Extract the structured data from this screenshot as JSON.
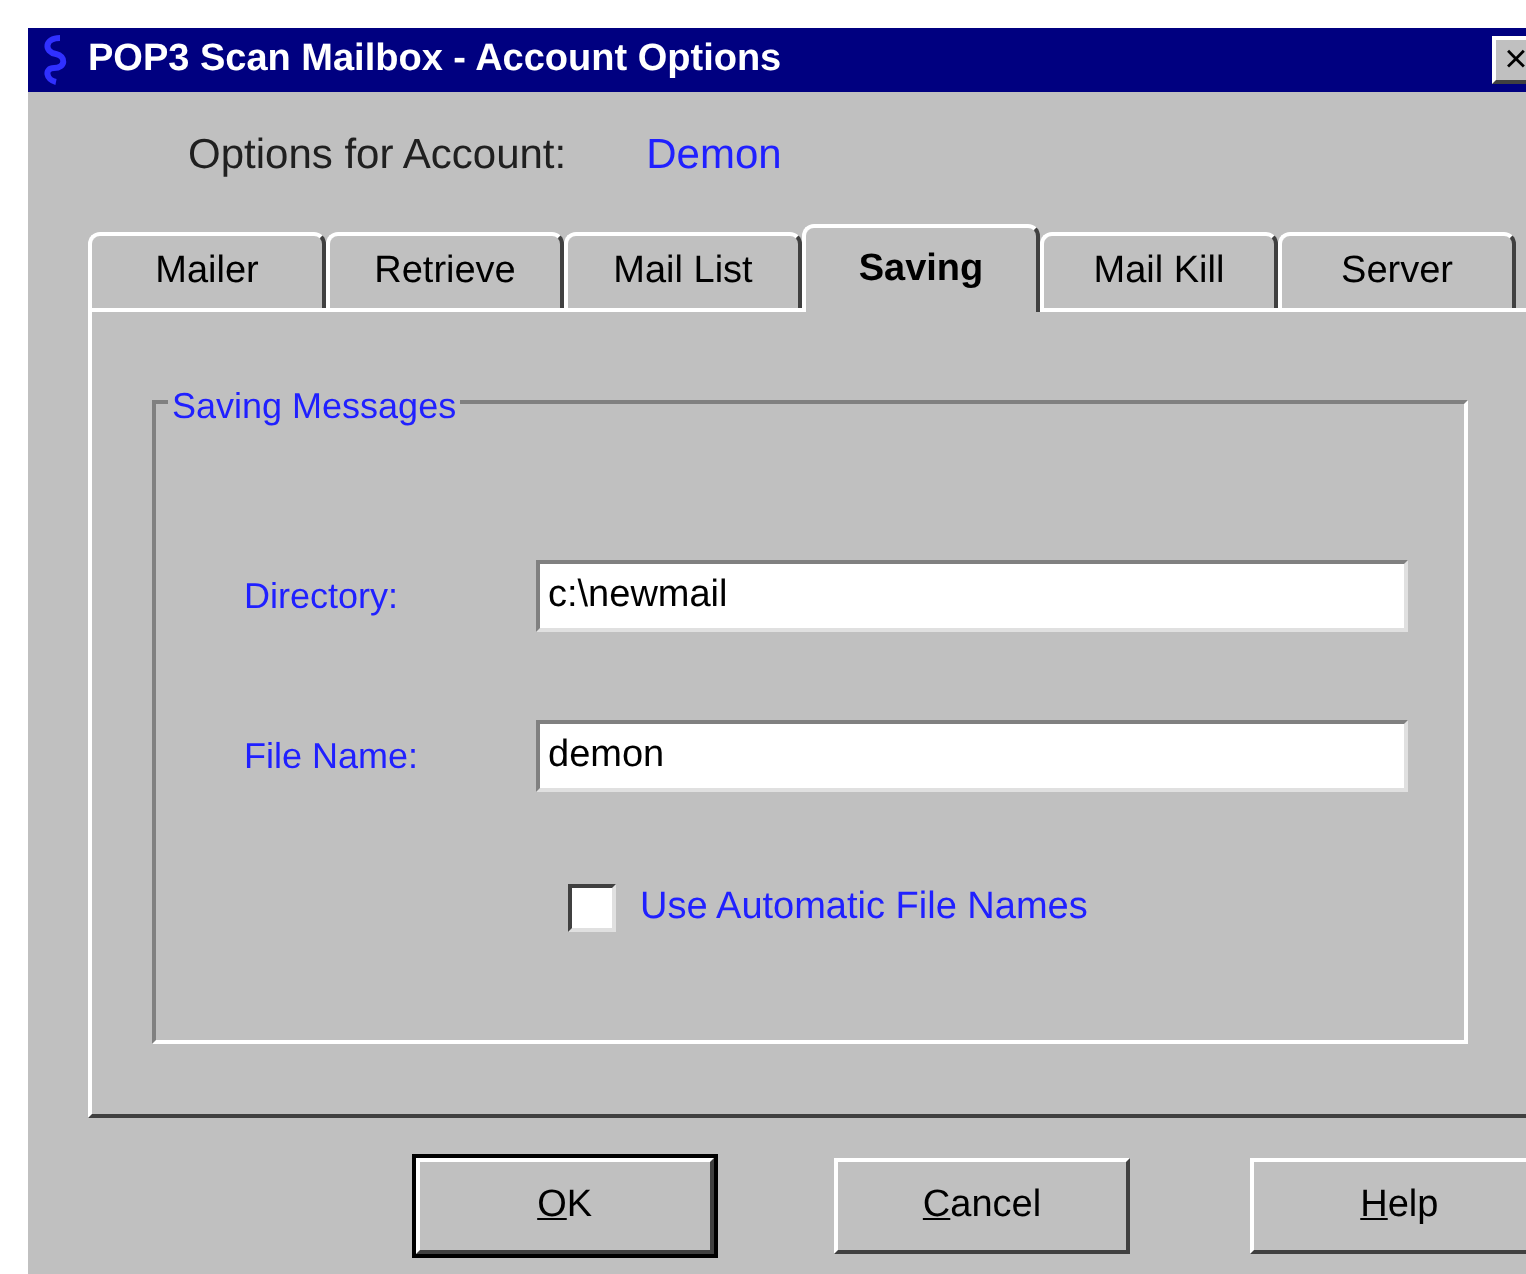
{
  "window": {
    "title": "POP3 Scan Mailbox - Account Options",
    "close": "×"
  },
  "account": {
    "label": "Options for Account:",
    "value": "Demon"
  },
  "tabs": [
    {
      "label": "Mailer",
      "selected": false
    },
    {
      "label": "Retrieve",
      "selected": false
    },
    {
      "label": "Mail List",
      "selected": false
    },
    {
      "label": "Saving",
      "selected": true
    },
    {
      "label": "Mail Kill",
      "selected": false
    },
    {
      "label": "Server",
      "selected": false
    }
  ],
  "group": {
    "title": "Saving Messages",
    "fields": [
      {
        "label": "Directory:",
        "value": "c:\\newmail"
      },
      {
        "label": "File Name:",
        "value": "demon"
      }
    ],
    "checkbox": {
      "label": "Use Automatic File Names",
      "checked": false
    }
  },
  "buttons": [
    {
      "underlined": "O",
      "rest": "K",
      "default": true
    },
    {
      "underlined": "C",
      "rest": "ancel",
      "default": false
    },
    {
      "underlined": "H",
      "rest": "elp",
      "default": false
    }
  ]
}
